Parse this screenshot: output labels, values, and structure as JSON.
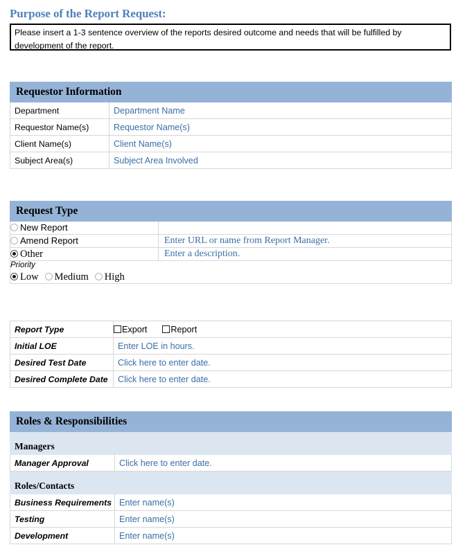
{
  "purpose": {
    "heading": "Purpose of the Report Request:",
    "body": "Please insert a 1-3 sentence overview of the reports desired outcome and needs that will be fulfilled by development of the report."
  },
  "requestor_information": {
    "title": "Requestor Information",
    "rows": [
      {
        "label": "Department",
        "value": "Department Name"
      },
      {
        "label": "Requestor Name(s)",
        "value": "Requestor Name(s)"
      },
      {
        "label": "Client Name(s)",
        "value": "Client Name(s)"
      },
      {
        "label": "Subject Area(s)",
        "value": "Subject Area Involved"
      }
    ]
  },
  "request_type": {
    "title": "Request Type",
    "options": [
      {
        "label": "New Report",
        "selected": false,
        "value": ""
      },
      {
        "label": "Amend Report",
        "selected": false,
        "value": "Enter URL or name from Report Manager."
      },
      {
        "label": "Other",
        "selected": true,
        "value": "Enter a description."
      }
    ],
    "priority": {
      "label": "Priority",
      "options": [
        {
          "label": "Low",
          "selected": true
        },
        {
          "label": "Medium",
          "selected": false
        },
        {
          "label": "High",
          "selected": false
        }
      ]
    },
    "report_type": {
      "label": "Report Type",
      "checkboxes": [
        {
          "label": "Export",
          "checked": false
        },
        {
          "label": "Report",
          "checked": false
        }
      ]
    },
    "details": [
      {
        "label": "Initial LOE",
        "value": "Enter LOE in hours."
      },
      {
        "label": "Desired Test Date",
        "value": "Click here to enter date."
      },
      {
        "label": "Desired Complete Date",
        "value": "Click here to enter date."
      }
    ]
  },
  "roles_responsibilities": {
    "title": "Roles & Responsibilities",
    "managers": {
      "heading": "Managers",
      "rows": [
        {
          "label": "Manager Approval",
          "value": "Click here to enter date."
        }
      ]
    },
    "roles_contacts": {
      "heading": "Roles/Contacts",
      "rows": [
        {
          "label": "Business Requirements",
          "value": "Enter name(s)"
        },
        {
          "label": "Testing",
          "value": "Enter name(s)"
        },
        {
          "label": "Development",
          "value": "Enter name(s)"
        }
      ]
    }
  },
  "colors": {
    "heading_blue": "#4f81bd",
    "band_blue": "#95b3d7",
    "subband_blue": "#dce6f1",
    "placeholder_blue": "#3a6ea8",
    "border_gray": "#d6d6d6"
  }
}
